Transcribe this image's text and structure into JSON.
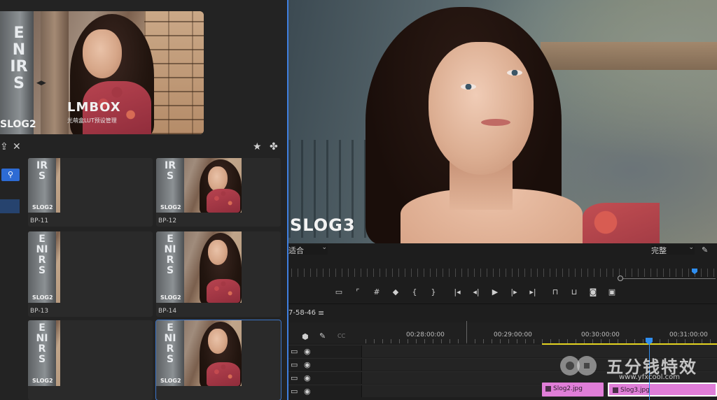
{
  "preview": {
    "sign_text": "ENIRS",
    "brand_title": "LMBOX",
    "brand_subtitle": "光萌盒LUT预设管理",
    "log_label": "SLOG2"
  },
  "browser": {
    "items": [
      {
        "name": "BP-11",
        "thumb_label": "SLOG2",
        "sign_text": "IRS"
      },
      {
        "name": "BP-12",
        "thumb_label": "SLOG2",
        "sign_text": "IRS"
      },
      {
        "name": "BP-13",
        "thumb_label": "SLOG2",
        "sign_text": "ENIRS"
      },
      {
        "name": "BP-14",
        "thumb_label": "SLOG2",
        "sign_text": "ENIRS"
      },
      {
        "name": "",
        "thumb_label": "SLOG2",
        "sign_text": "ENIRS"
      },
      {
        "name": "",
        "thumb_label": "SLOG2",
        "sign_text": "ENIRS"
      }
    ]
  },
  "monitor": {
    "log_label": "SLOG3",
    "zoom_value": "适合",
    "quality_value": "完整"
  },
  "timeline": {
    "sequence_name": "7-58-46",
    "timecodes": [
      "00:28:00:00",
      "00:29:00:00",
      "00:30:00:00",
      "00:31:00:00"
    ],
    "clips": [
      {
        "name": "Slog2.jpg"
      },
      {
        "name": "Slog3.jpg"
      }
    ]
  },
  "watermark": {
    "brand": "五分钱特效",
    "url": "www.yfxcool.com"
  },
  "colors": {
    "accent": "#2f8ef0",
    "clip": "#e07ed8",
    "work_area": "#e3d21f"
  }
}
